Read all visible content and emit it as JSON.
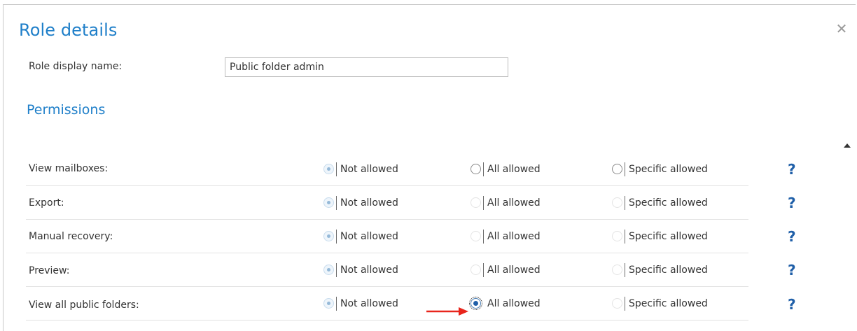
{
  "dialog": {
    "title": "Role details",
    "close_icon": "close-icon"
  },
  "role": {
    "display_name_label": "Role display name:",
    "display_name_value": "Public folder admin"
  },
  "permissions": {
    "section_title": "Permissions",
    "options": [
      "Not allowed",
      "All allowed",
      "Specific allowed"
    ],
    "help_label": "?",
    "rows": [
      {
        "label": "View mailboxes:",
        "selected": "Not allowed"
      },
      {
        "label": "Export:",
        "selected": "Not allowed"
      },
      {
        "label": "Manual recovery:",
        "selected": "Not allowed"
      },
      {
        "label": "Preview:",
        "selected": "Not allowed"
      },
      {
        "label": "View all public folders:",
        "selected": "All allowed"
      }
    ]
  },
  "annotation": {
    "arrow_color": "#e8251c",
    "arrow_icon": "red-arrow-icon"
  },
  "colors": {
    "accent": "#1f7fc9",
    "help": "#1f5fa8"
  }
}
